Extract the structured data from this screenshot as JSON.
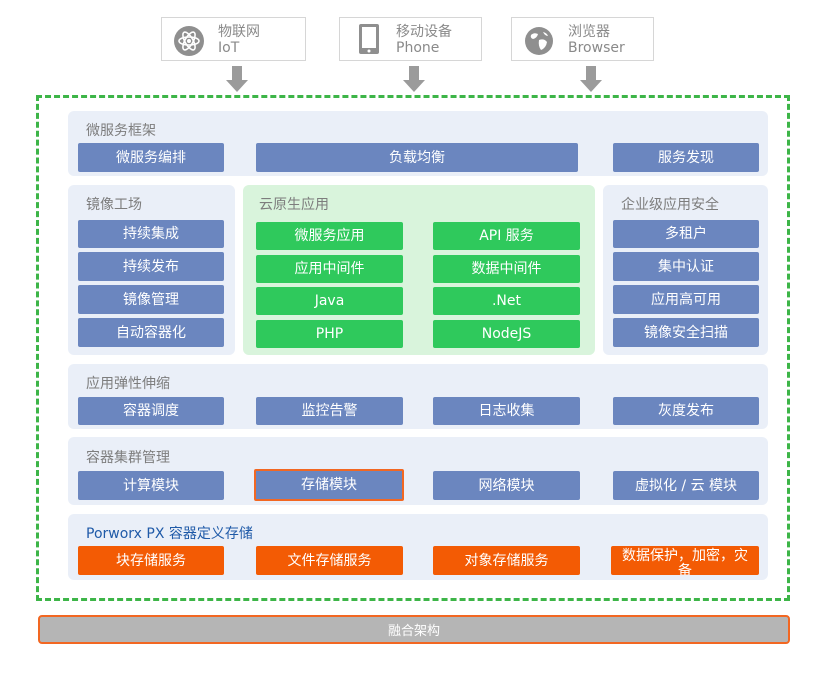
{
  "clients": [
    {
      "icon": "atom-icon",
      "line1": "物联网",
      "line2": "IoT"
    },
    {
      "icon": "phone-icon",
      "line1": "移动设备",
      "line2": "Phone"
    },
    {
      "icon": "globe-icon",
      "line1": "浏览器",
      "line2": "Browser"
    }
  ],
  "micro": {
    "title": "微服务框架",
    "items": [
      "微服务编排",
      "负载均衡",
      "服务发现"
    ]
  },
  "image_factory": {
    "title": "镜像工场",
    "items": [
      "持续集成",
      "持续发布",
      "镜像管理",
      "自动容器化"
    ]
  },
  "cloud_native": {
    "title": "云原生应用",
    "items": [
      "微服务应用",
      "API 服务",
      "应用中间件",
      "数据中间件",
      "Java",
      ".Net",
      "PHP",
      "NodeJS"
    ]
  },
  "security": {
    "title": "企业级应用安全",
    "items": [
      "多租户",
      "集中认证",
      "应用高可用",
      "镜像安全扫描"
    ]
  },
  "elastic": {
    "title": "应用弹性伸缩",
    "items": [
      "容器调度",
      "监控告警",
      "日志收集",
      "灰度发布"
    ]
  },
  "cluster": {
    "title": "容器集群管理",
    "items": [
      "计算模块",
      "存储模块",
      "网络模块",
      "虚拟化 / 云 模块"
    ]
  },
  "storage": {
    "title": "Porworx PX 容器定义存储",
    "items": [
      "块存储服务",
      "文件存储服务",
      "对象存储服务",
      "数据保护，加密，灾备"
    ]
  },
  "bottom": {
    "label": "融合架构"
  },
  "colors": {
    "blue_button": "#6b86bf",
    "green_button": "#2fc95c",
    "orange_button": "#f35b04",
    "dashed_border": "#3db548",
    "panel": "#eaeff8"
  }
}
